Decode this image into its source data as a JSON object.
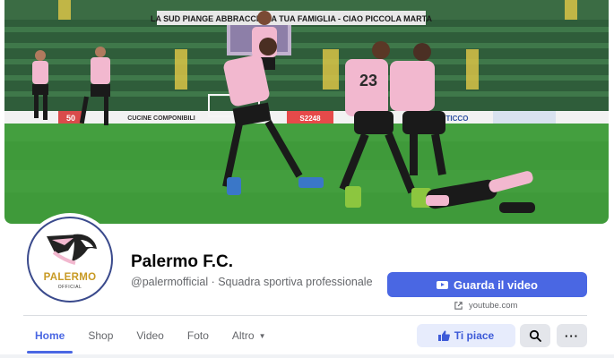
{
  "cover": {
    "banner_text": "LA SUD PIANGE ABBRACCIA LA TUA FAMIGLIA - CIAO PICCOLA MARTA",
    "ad_left_text": "50",
    "ad_componibili": "CUCINE COMPONIBILI",
    "ad_score": "S2248",
    "ad_right": "TICCO",
    "player_numbers": [
      "23"
    ],
    "colors": {
      "pitch": "#3f9a3a",
      "stands": "#2f5d3a",
      "jersey": "#f2b8cf",
      "shorts": "#1a1a1a"
    }
  },
  "profile": {
    "logo_word": "PALERMO",
    "logo_sub": "OFFICIAL",
    "name": "Palermo F.C.",
    "subtitle": "@palermofficial · Squadra sportiva professionale"
  },
  "actions": {
    "video_label": "Guarda il video",
    "video_icon": "youtube-icon",
    "video_domain": "youtube.com",
    "like_label": "Ti piace",
    "like_icon": "thumbs-up-icon",
    "search_icon": "search-icon",
    "more_label": "···"
  },
  "tabs": [
    {
      "label": "Home",
      "active": true
    },
    {
      "label": "Shop"
    },
    {
      "label": "Video"
    },
    {
      "label": "Foto"
    },
    {
      "label": "Altro"
    }
  ],
  "colors": {
    "accent": "#4a67e3",
    "text_secondary": "#65676b",
    "button_grey": "#e4e6eb"
  }
}
